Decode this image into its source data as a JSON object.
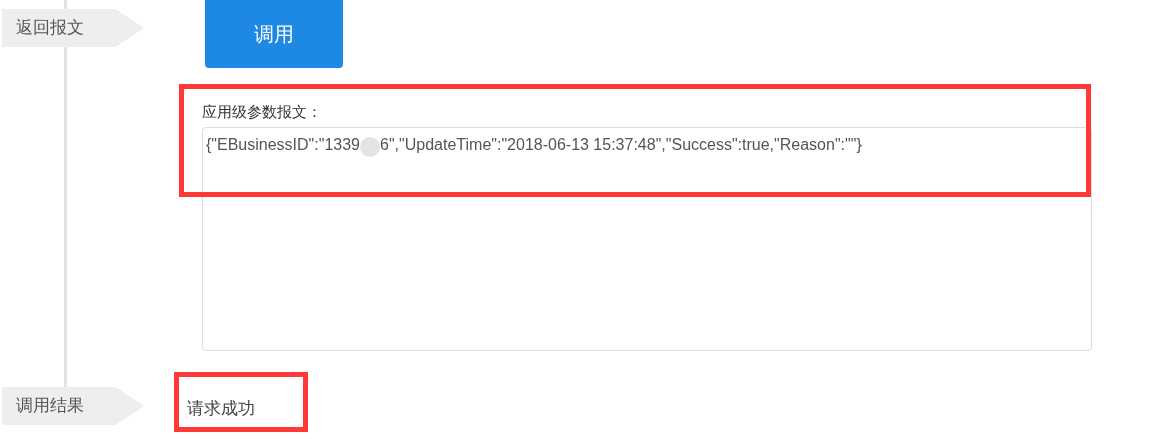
{
  "steps": [
    {
      "label": "返回报文"
    },
    {
      "label": "调用结果"
    }
  ],
  "invoke_button": {
    "label": "调用"
  },
  "response": {
    "label": "应用级参数报文：",
    "value_before_redaction": "{\"EBusinessID\":\"1339",
    "value_after_redaction": "6\",\"UpdateTime\":\"2018-06-13 15:37:48\",\"Success\":true,\"Reason\":\"\"}"
  },
  "result": {
    "text": "请求成功"
  }
}
